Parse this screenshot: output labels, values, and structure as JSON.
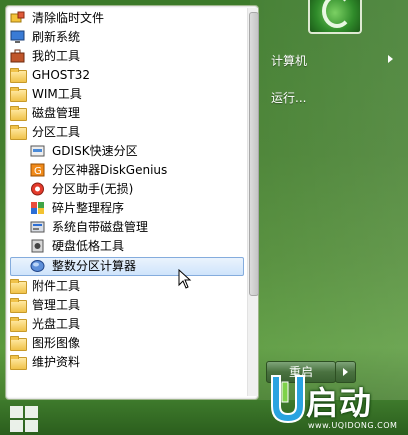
{
  "programs": [
    {
      "label": "清除临时文件",
      "icon": "eraser-icon",
      "level": 0
    },
    {
      "label": "刷新系统",
      "icon": "monitor-icon",
      "level": 0
    },
    {
      "label": "我的工具",
      "icon": "toolbox-icon",
      "level": 0
    },
    {
      "label": "GHOST32",
      "icon": "folder-icon",
      "level": 0
    },
    {
      "label": "WIM工具",
      "icon": "folder-icon",
      "level": 0
    },
    {
      "label": "磁盘管理",
      "icon": "folder-icon",
      "level": 0
    },
    {
      "label": "分区工具",
      "icon": "folder-icon",
      "level": 0
    },
    {
      "label": "GDISK快速分区",
      "icon": "gdisk-icon",
      "level": 1
    },
    {
      "label": "分区神器DiskGenius",
      "icon": "diskgenius-icon",
      "level": 1
    },
    {
      "label": "分区助手(无损)",
      "icon": "partition-assistant-icon",
      "level": 1
    },
    {
      "label": "碎片整理程序",
      "icon": "defrag-icon",
      "level": 1
    },
    {
      "label": "系统自带磁盘管理",
      "icon": "disk-management-icon",
      "level": 1
    },
    {
      "label": "硬盘低格工具",
      "icon": "low-format-icon",
      "level": 1
    },
    {
      "label": "整数分区计算器",
      "icon": "calculator-icon",
      "level": 1,
      "selected": true
    },
    {
      "label": "附件工具",
      "icon": "folder-icon",
      "level": 0
    },
    {
      "label": "管理工具",
      "icon": "folder-icon",
      "level": 0
    },
    {
      "label": "光盘工具",
      "icon": "folder-icon",
      "level": 0
    },
    {
      "label": "图形图像",
      "icon": "folder-icon",
      "level": 0
    },
    {
      "label": "维护资料",
      "icon": "folder-icon",
      "level": 0
    }
  ],
  "right": {
    "computer_label": "计算机",
    "run_label": "运行..."
  },
  "restart_label": "重启",
  "brand": {
    "word": "启动",
    "url": "www.UQIDONG.COM"
  },
  "colors": {
    "accent_green": "#447f2e",
    "selection_border": "#84acdd",
    "folder_yellow": "#f0c24a"
  }
}
